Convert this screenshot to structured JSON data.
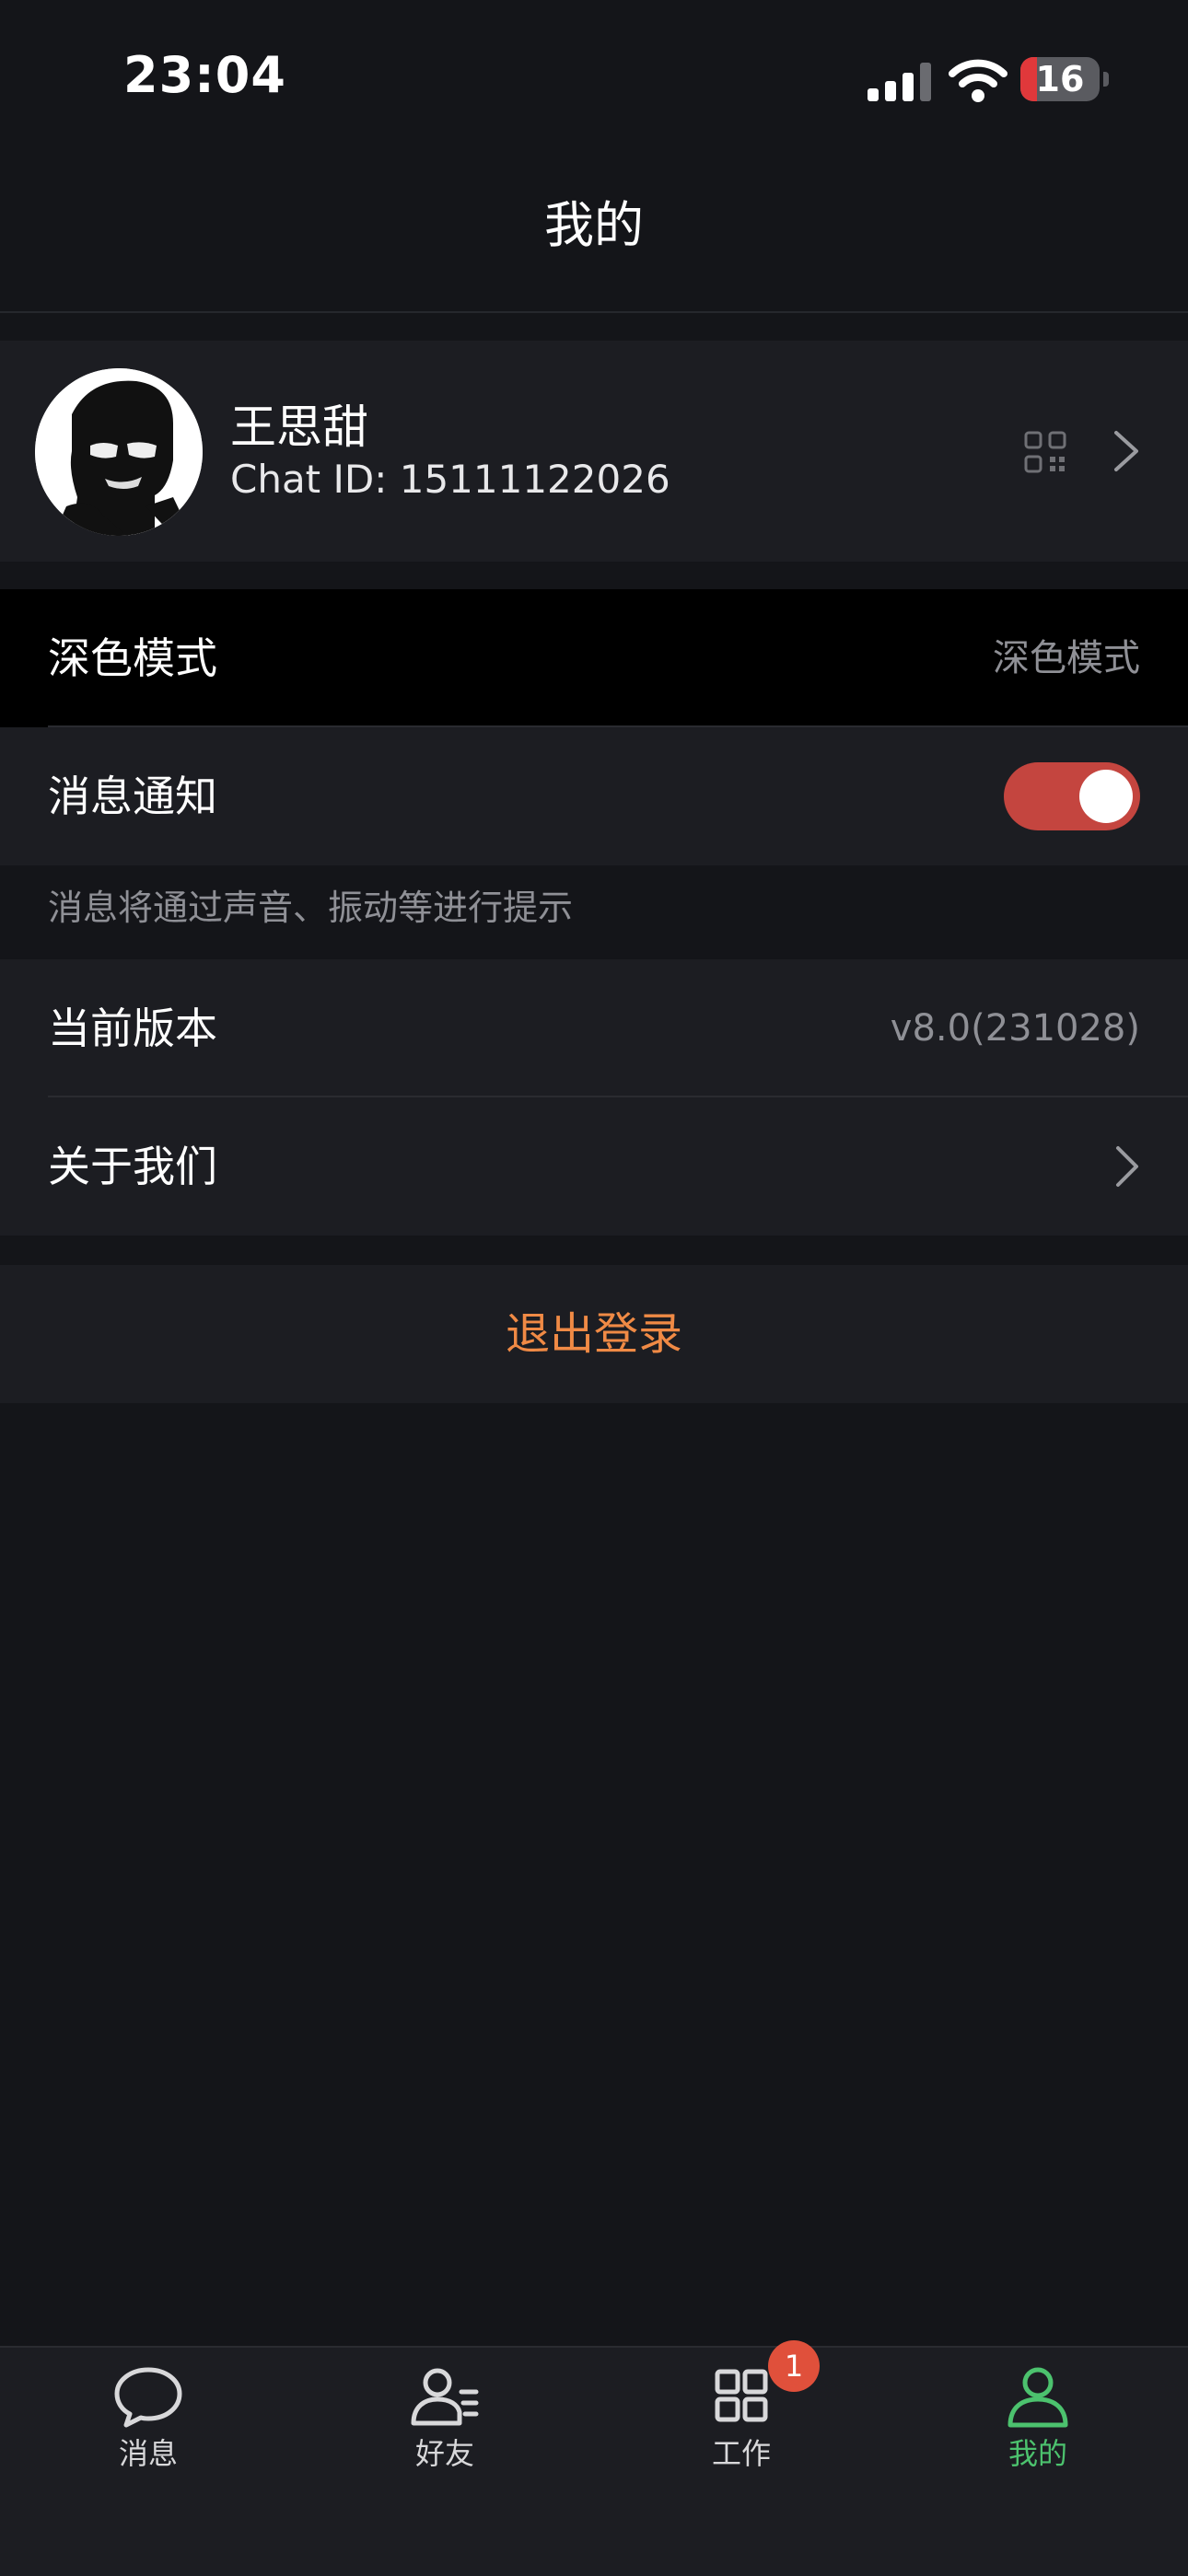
{
  "status_bar": {
    "time": "23:04",
    "battery": "16"
  },
  "header": {
    "title": "我的"
  },
  "profile": {
    "name": "王思甜",
    "chat_id": "Chat ID: 15111122026"
  },
  "settings": {
    "dark_mode": {
      "label": "深色模式",
      "value": "深色模式"
    },
    "notifications": {
      "label": "消息通知",
      "enabled": true,
      "hint": "消息将通过声音、振动等进行提示"
    },
    "version": {
      "label": "当前版本",
      "value": "v8.0(231028)"
    },
    "about": {
      "label": "关于我们"
    }
  },
  "logout": {
    "label": "退出登录"
  },
  "tabbar": {
    "items": [
      {
        "label": "消息",
        "icon": "chat-bubble-icon"
      },
      {
        "label": "好友",
        "icon": "contacts-icon"
      },
      {
        "label": "工作",
        "icon": "grid-icon",
        "badge": "1"
      },
      {
        "label": "我的",
        "icon": "person-icon",
        "active": true
      }
    ]
  },
  "colors": {
    "accent": "#4cc26e",
    "toggle": "#c4453f",
    "logout": "#f08a45",
    "badge": "#e0503b"
  }
}
